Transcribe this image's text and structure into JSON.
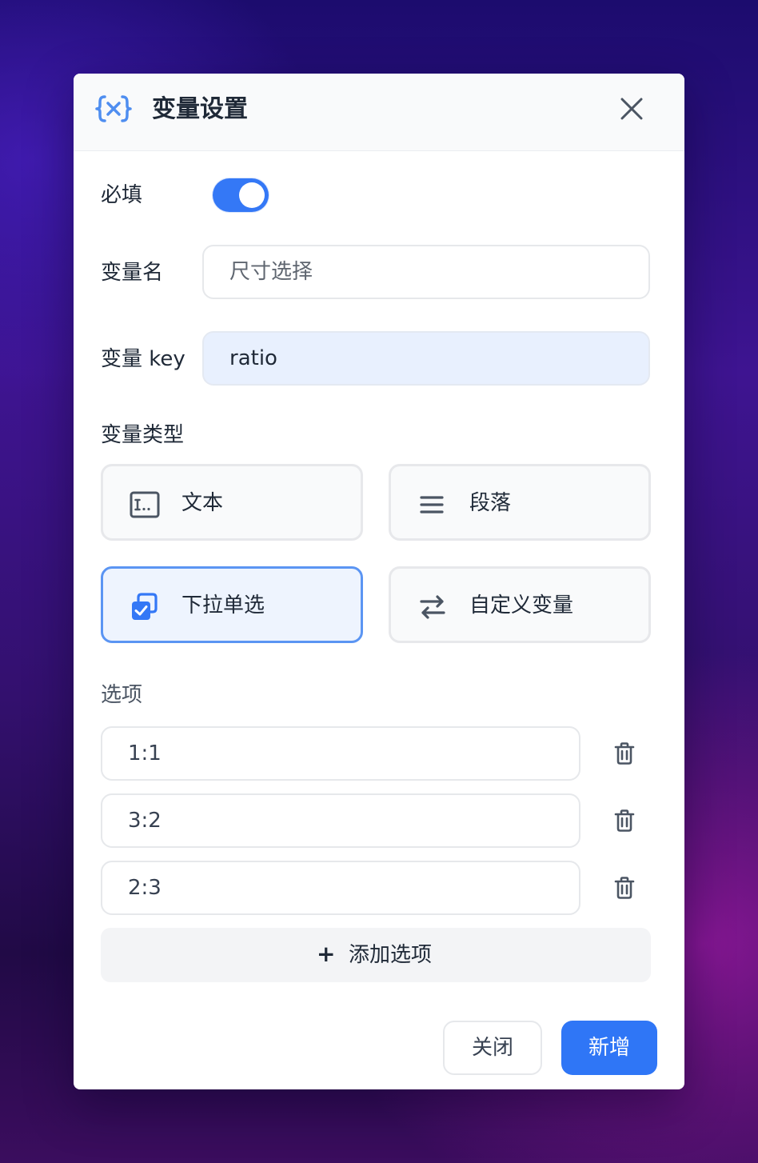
{
  "dialog": {
    "title": "变量设置",
    "logo_icon": "curly-braces-x-icon",
    "close_icon": "close-icon"
  },
  "form": {
    "required": {
      "label": "必填",
      "enabled": true
    },
    "name": {
      "label": "变量名",
      "value": "",
      "placeholder": "尺寸选择"
    },
    "key": {
      "label": "变量 key",
      "value": "ratio"
    },
    "type": {
      "label": "变量类型",
      "options": [
        {
          "label": "文本",
          "icon": "text-field-icon",
          "selected": false
        },
        {
          "label": "段落",
          "icon": "paragraph-lines-icon",
          "selected": false
        },
        {
          "label": "下拉单选",
          "icon": "dropdown-select-icon",
          "selected": true
        },
        {
          "label": "自定义变量",
          "icon": "swap-arrows-icon",
          "selected": false
        }
      ]
    },
    "options": {
      "label": "选项",
      "items": [
        "1:1",
        "3:2",
        "2:3"
      ],
      "delete_icon": "trash-icon",
      "add_label": "添加选项",
      "add_symbol": "+"
    }
  },
  "footer": {
    "close_label": "关闭",
    "submit_label": "新增"
  },
  "colors": {
    "accent": "#2f76f6",
    "logo": "#4f8ef0",
    "selected_border": "#5b95f3",
    "selected_bg": "#eef4fe",
    "key_field_bg": "#e8f0fe"
  }
}
